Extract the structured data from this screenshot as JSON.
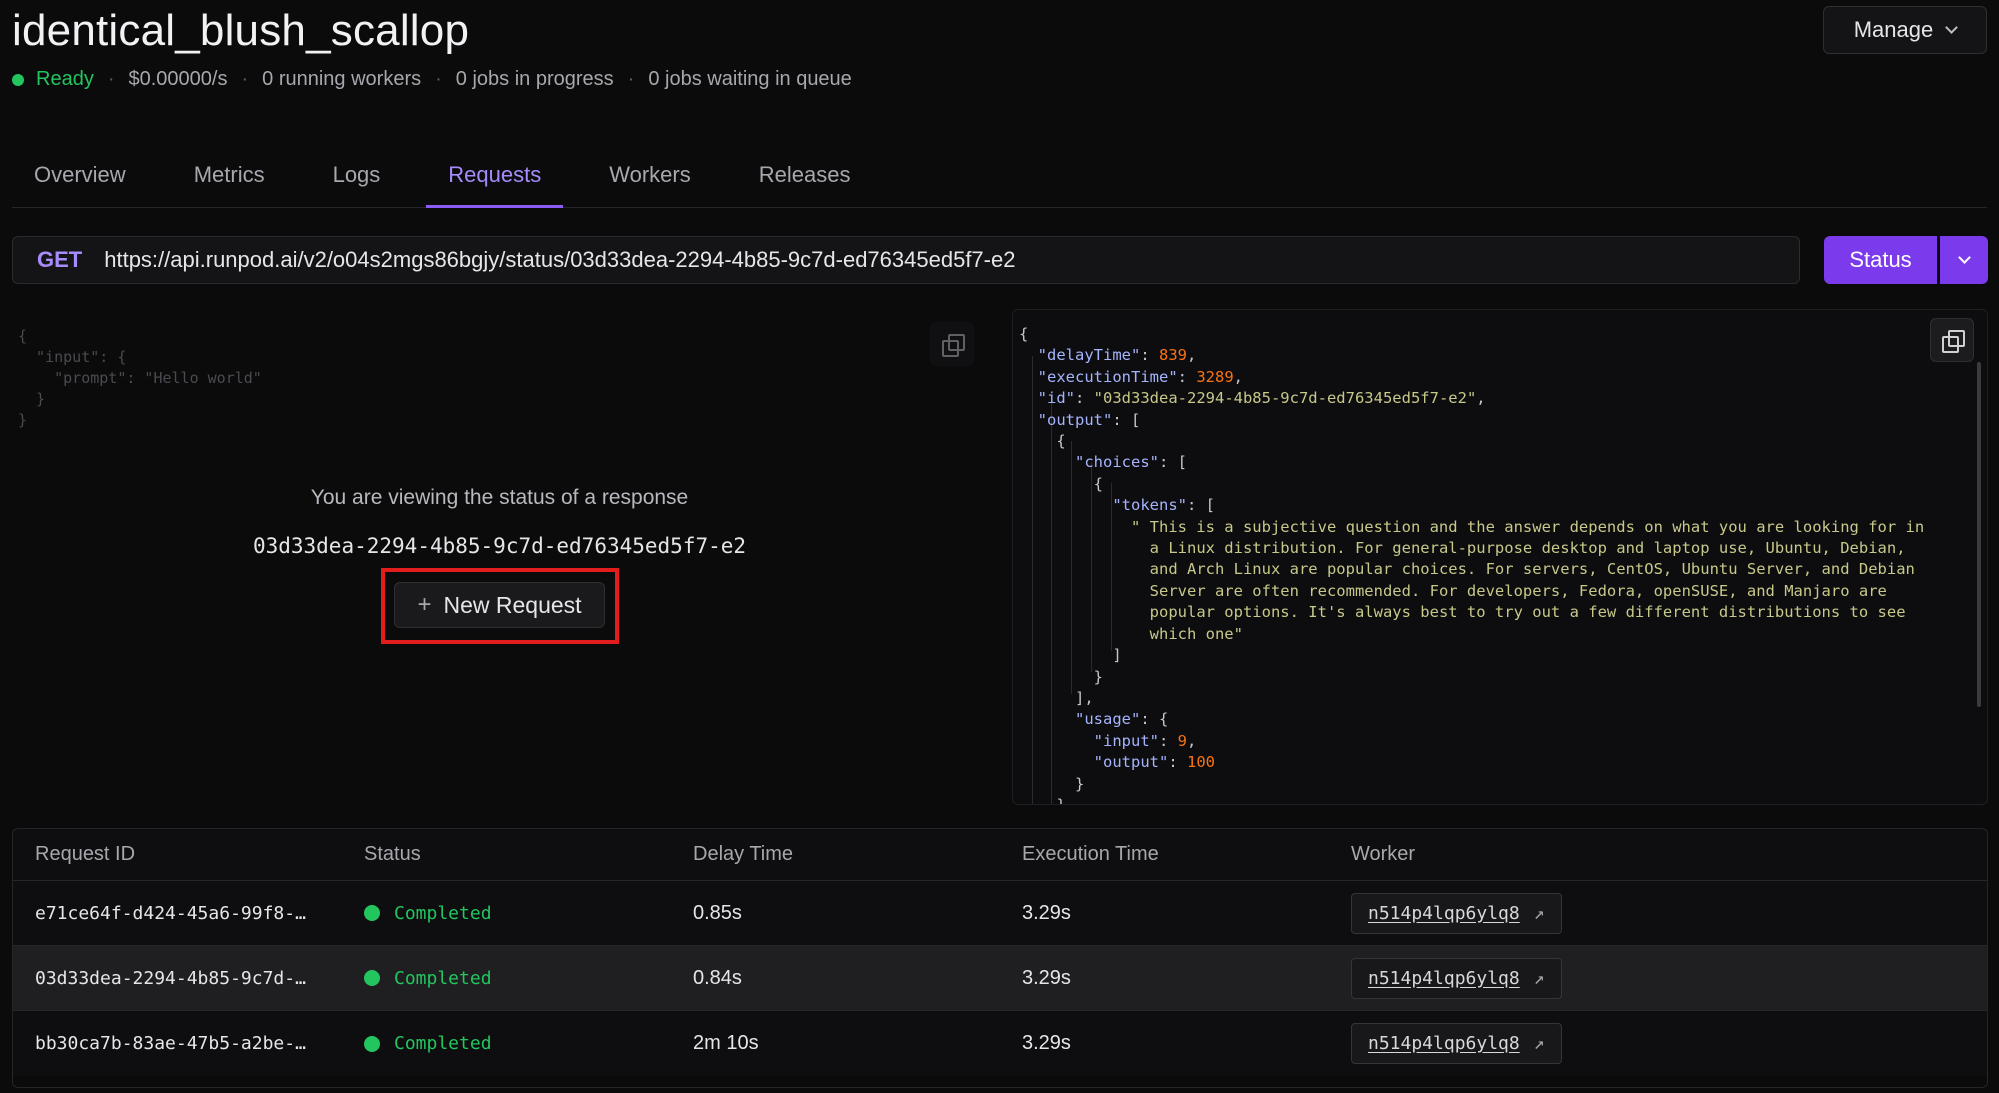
{
  "header": {
    "title": "identical_blush_scallop",
    "status": "Ready",
    "cost": "$0.00000/s",
    "running_workers": "0 running workers",
    "jobs_in_progress": "0 jobs in progress",
    "jobs_in_queue": "0 jobs waiting in queue",
    "manage_label": "Manage"
  },
  "tabs": [
    {
      "label": "Overview"
    },
    {
      "label": "Metrics"
    },
    {
      "label": "Logs"
    },
    {
      "label": "Requests"
    },
    {
      "label": "Workers"
    },
    {
      "label": "Releases"
    }
  ],
  "active_tab": "Requests",
  "request_bar": {
    "method": "GET",
    "url": "https://api.runpod.ai/v2/o04s2mgs86bgjy/status/03d33dea-2294-4b85-9c7d-ed76345ed5f7-e2",
    "action_label": "Status"
  },
  "input_panel": {
    "code": "{\n  \"input\": {\n    \"prompt\": \"Hello world\"\n  }\n}",
    "viewing_text": "You are viewing the status of a response",
    "response_id": "03d33dea-2294-4b85-9c7d-ed76345ed5f7-e2",
    "new_request_label": "New Request"
  },
  "response_json": {
    "delayTime": "839",
    "executionTime": "3289",
    "id": "\"03d33dea-2294-4b85-9c7d-ed76345ed5f7-e2\"",
    "token_text": [
      "\" This is a subjective question and the answer depends on what you are looking for in",
      "a Linux distribution. For general-purpose desktop and laptop use, Ubuntu, Debian,",
      "and Arch Linux are popular choices. For servers, CentOS, Ubuntu Server, and Debian",
      "Server are often recommended. For developers, Fedora, openSUSE, and Manjaro are",
      "popular options. It's always best to try out a few different distributions to see",
      "which one\""
    ],
    "usage_input": "9",
    "usage_output": "100"
  },
  "table": {
    "headers": [
      "Request ID",
      "Status",
      "Delay Time",
      "Execution Time",
      "Worker"
    ],
    "rows": [
      {
        "id": "e71ce64f-d424-45a6-99f8-…",
        "status": "Completed",
        "delay": "0.85s",
        "exec": "3.29s",
        "worker": "n514p4lqp6ylq8"
      },
      {
        "id": "03d33dea-2294-4b85-9c7d-…",
        "status": "Completed",
        "delay": "0.84s",
        "exec": "3.29s",
        "worker": "n514p4lqp6ylq8"
      },
      {
        "id": "bb30ca7b-83ae-47b5-a2be-…",
        "status": "Completed",
        "delay": "2m 10s",
        "exec": "3.29s",
        "worker": "n514p4lqp6ylq8"
      }
    ]
  },
  "colors": {
    "accent": "#7c3aed",
    "ready": "#22c55e",
    "highlight": "#e11d1d"
  }
}
